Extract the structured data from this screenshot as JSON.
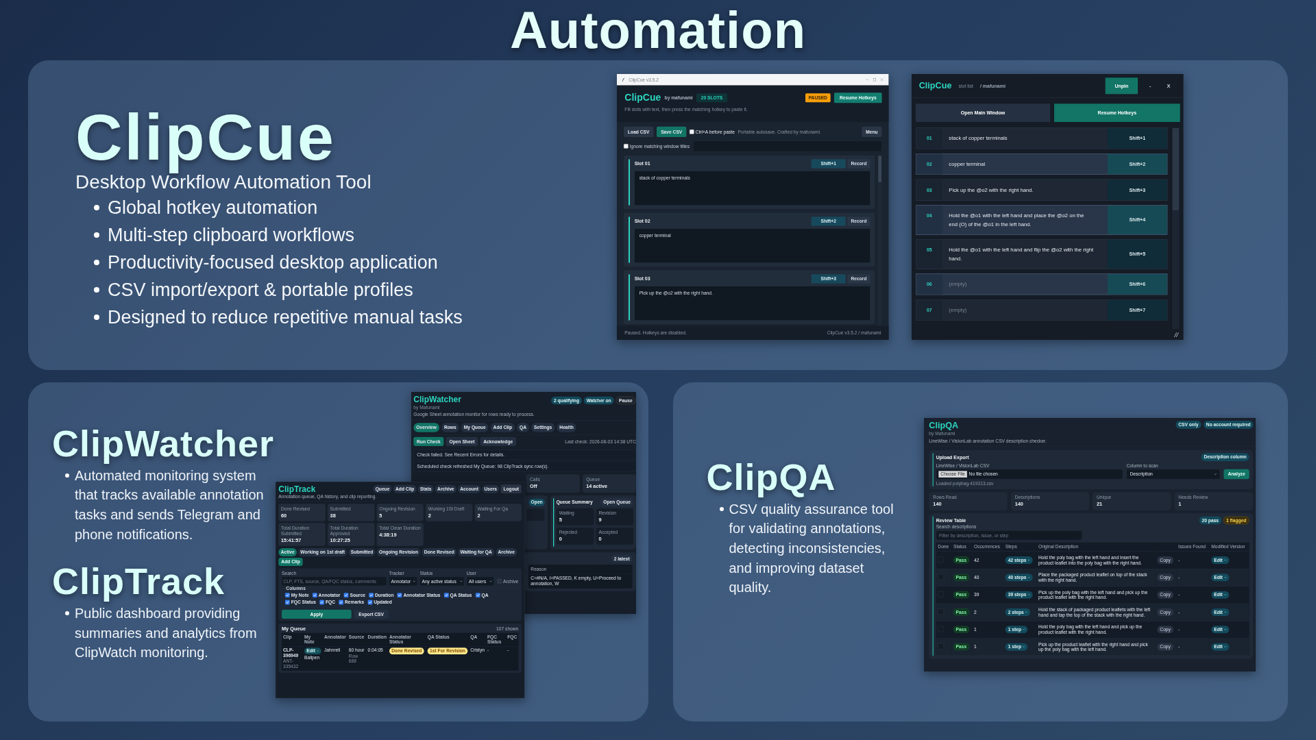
{
  "heading": "Automation",
  "clipcue": {
    "name": "ClipCue",
    "tagline": "Desktop Workflow Automation Tool",
    "features": [
      "Global hotkey automation",
      "Multi-step clipboard workflows",
      "Productivity-focused desktop application",
      "CSV import/export & portable profiles",
      "Designed to reduce repetitive manual tasks"
    ],
    "main_window": {
      "titlebar": "ClipCue v3.5.2",
      "app_name": "ClipCue",
      "by": "by mafunami",
      "slots_badge": "20 SLOTS",
      "status_badge": "PAUSED",
      "resume_button": "Resume Hotkeys",
      "hint": "Fill slots with text, then press the matching hotkey to paste it.",
      "load_button": "Load CSV",
      "save_button": "Save CSV",
      "ctrl_a": {
        "label": "Ctrl+A before paste",
        "checked": false
      },
      "note": "Portable autosave. Crafted by mafunami.",
      "menu_button": "Menu",
      "ignore_titles": {
        "label": "Ignore matching window titles",
        "checked": false
      },
      "slots": [
        {
          "title": "Slot 01",
          "hotkey": "Shift+1",
          "record": "Record",
          "text": "stack of copper terminals"
        },
        {
          "title": "Slot 02",
          "hotkey": "Shift+2",
          "record": "Record",
          "text": "copper terminal"
        },
        {
          "title": "Slot 03",
          "hotkey": "Shift+3",
          "record": "Record",
          "text": "Pick up the @o2 with the right hand."
        }
      ],
      "status": "Paused. Hotkeys are disabled.",
      "version": "ClipCue v3.5.2 / mafunami"
    },
    "slot_list_window": {
      "app_name": "ClipCue",
      "subtitle": "slot list",
      "user": "/ mafunami",
      "unpin_button": "Unpin",
      "minimize_button": "-",
      "close_button": "X",
      "open_main_button": "Open Main Window",
      "resume_button": "Resume Hotkeys",
      "slots": [
        {
          "number": "01",
          "text": "stack of copper terminals",
          "hotkey": "Shift+1",
          "highlighted": false,
          "empty": false
        },
        {
          "number": "02",
          "text": "copper terminal",
          "hotkey": "Shift+2",
          "highlighted": true,
          "empty": false
        },
        {
          "number": "03",
          "text": "Pick up the @o2 with the right hand.",
          "hotkey": "Shift+3",
          "highlighted": false,
          "empty": false
        },
        {
          "number": "04",
          "text": "Hold the @o1 with the left hand and place the @o2 on the end (O) of the @o1 in the left hand.",
          "hotkey": "Shift+4",
          "highlighted": true,
          "empty": false
        },
        {
          "number": "05",
          "text": "Hold the @o1 with the left hand and flip the @o2 with the right hand.",
          "hotkey": "Shift+5",
          "highlighted": false,
          "empty": false
        },
        {
          "number": "06",
          "text": "(empty)",
          "hotkey": "Shift+6",
          "highlighted": true,
          "empty": true
        },
        {
          "number": "07",
          "text": "(empty)",
          "hotkey": "Shift+7",
          "highlighted": false,
          "empty": true
        }
      ]
    }
  },
  "clipwatcher": {
    "name": "ClipWatcher",
    "features": [
      "Automated monitoring system that tracks available annotation tasks and sends Telegram and phone notifications."
    ],
    "window": {
      "app_name": "ClipWatcher",
      "by": "by Mafunami",
      "description": "Google Sheet annotation monitor for rows ready to process.",
      "badges": [
        "2 qualifying",
        "Watcher on"
      ],
      "pause_button": "Pause",
      "tabs": [
        {
          "label": "Overview",
          "selected": true
        },
        {
          "label": "Rows",
          "selected": false
        },
        {
          "label": "My Queue",
          "selected": false
        },
        {
          "label": "Add Clip",
          "selected": false
        },
        {
          "label": "QA",
          "selected": false
        },
        {
          "label": "Settings",
          "selected": false
        },
        {
          "label": "Health",
          "selected": false
        }
      ],
      "actions": [
        {
          "label": "Run Check",
          "kind": "primary"
        },
        {
          "label": "Open Sheet",
          "kind": "secondary"
        },
        {
          "label": "Acknowledge",
          "kind": "secondary"
        }
      ],
      "last_check": "Last check: 2026-08-03 14:38 UTC",
      "alerts": [
        "Check failed. See Recent Errors for details.",
        "Scheduled check refreshed My Queue: 98 ClipTrack sync row(s)."
      ],
      "stats": [
        {
          "label": "Calls",
          "value": "Off"
        },
        {
          "label": "Queue",
          "value": "14 active"
        }
      ],
      "open_badge": "Open",
      "queue_summary": {
        "title": "Queue Summary",
        "button": "Open Queue",
        "cells": [
          {
            "label": "Waiting",
            "value": "5"
          },
          {
            "label": "Revision",
            "value": "9"
          },
          {
            "label": "Rejected",
            "value": "0"
          },
          {
            "label": "Accepted",
            "value": "0"
          }
        ]
      },
      "latest_badge": "2 latest",
      "reason_header": "Reason",
      "reason_text": "C=#N/A, I=PASSED, K empty, U=Proceed to annotation, W"
    }
  },
  "cliptrack": {
    "name": "ClipTrack",
    "features": [
      "Public dashboard providing summaries and analytics from ClipWatch monitoring."
    ],
    "window": {
      "app_name": "ClipTrack",
      "description": "Annotation queue, QA history, and clip reporting.",
      "nav": [
        {
          "label": "Queue",
          "kind": "pill"
        },
        {
          "label": "Add Clip",
          "kind": "pill"
        },
        {
          "label": "Stats",
          "kind": "pill"
        },
        {
          "label": "Archive",
          "kind": "pill"
        },
        {
          "label": "Account",
          "kind": "pill"
        },
        {
          "label": "Users",
          "kind": "pill"
        },
        {
          "label": "Logout",
          "kind": "button"
        }
      ],
      "stats": [
        {
          "label": "Done Revised",
          "value": "60"
        },
        {
          "label": "Submitted",
          "value": "38"
        },
        {
          "label": "Ongoing Revision",
          "value": "5"
        },
        {
          "label": "Working 1St Draft",
          "value": "2"
        },
        {
          "label": "Waiting For Qa",
          "value": "2"
        },
        {
          "label": "Total Duration Submitted",
          "value": "15:41:57"
        },
        {
          "label": "Total Duration Approved",
          "value": "10:27:25"
        },
        {
          "label": "Total Clean Duration",
          "value": "4:38:19"
        }
      ],
      "filters": [
        {
          "label": "Active",
          "selected": true
        },
        {
          "label": "Working on 1st draft",
          "selected": false
        },
        {
          "label": "Submitted",
          "selected": false
        },
        {
          "label": "Ongoing Revision",
          "selected": false
        },
        {
          "label": "Done Revised",
          "selected": false
        },
        {
          "label": "Waiting for QA",
          "selected": false
        },
        {
          "label": "Archive",
          "selected": false
        }
      ],
      "add_clip_button": "Add Clip",
      "search": {
        "label": "Search",
        "placeholder": "CLP, FTS, source, QA/FQC status, comments"
      },
      "tracker": {
        "label": "Tracker",
        "value": "Annotator"
      },
      "status": {
        "label": "Status",
        "value": "Any active status"
      },
      "user": {
        "label": "User",
        "value": "All users"
      },
      "archive": {
        "label": "Archive",
        "checked": false
      },
      "columns_legend": "Columns",
      "columns": [
        {
          "label": "My Note",
          "checked": true
        },
        {
          "label": "Annotator",
          "checked": true
        },
        {
          "label": "Source",
          "checked": true
        },
        {
          "label": "Duration",
          "checked": true
        },
        {
          "label": "Annotator Status",
          "checked": true
        },
        {
          "label": "QA Status",
          "checked": true
        },
        {
          "label": "QA",
          "checked": true
        },
        {
          "label": "FQC Status",
          "checked": true
        },
        {
          "label": "FQC",
          "checked": true
        },
        {
          "label": "Remarks",
          "checked": true
        },
        {
          "label": "Updated",
          "checked": true
        }
      ],
      "apply_button": "Apply",
      "export_button": "Export CSV",
      "queue": {
        "title": "My Queue",
        "count": "107 shown",
        "columns": [
          "Clip",
          "My Note",
          "Annotator",
          "Source",
          "Duration",
          "Annotator Status",
          "QA Status",
          "QA",
          "FQC Status",
          "FQC"
        ],
        "rows": [
          {
            "clip": "CLP-396949",
            "clip_id": "ANT-335432",
            "note_button": "Edit",
            "note": "Ballpen",
            "annotator": "Jahnrell",
            "source": "60 hour",
            "source_row": "Row 688",
            "duration": "0:04:05",
            "annotator_status": "Done Revised",
            "qa_status": "1st For Revision",
            "qa": "Cristyn",
            "fqc_status": "-",
            "fqc": "-"
          }
        ]
      }
    }
  },
  "clipqa": {
    "name": "ClipQA",
    "features": [
      "CSV quality assurance tool for validating annotations, detecting inconsistencies, and improving dataset quality."
    ],
    "window": {
      "app_name": "ClipQA",
      "by": "by Mafunami",
      "description": "LineWise / VisionLab annotation CSV description checker.",
      "badges": [
        "CSV only",
        "No account required"
      ],
      "upload": {
        "title": "Upload Export",
        "badge": "Description column",
        "file_label": "LineWise / VisionLab CSV",
        "choose_button": "Choose File",
        "no_file": "No file chosen",
        "column_label": "Column to scan",
        "column_value": "Description",
        "analyze_button": "Analyze",
        "loaded": "Loaded polybag-419313.csv"
      },
      "stats": [
        {
          "label": "Rows Read",
          "value": "140"
        },
        {
          "label": "Descriptions",
          "value": "140"
        },
        {
          "label": "Unique",
          "value": "21"
        },
        {
          "label": "Needs Review",
          "value": "1"
        }
      ],
      "review": {
        "title": "Review Table",
        "pass_badge": "20 pass",
        "flag_badge": "1 flagged",
        "search_label": "Search descriptions",
        "search_placeholder": "Filter by description, issue, or step",
        "columns": [
          "Done",
          "Status",
          "Occurrences",
          "Steps",
          "Original Description",
          "Issues Found",
          "Modified Version"
        ],
        "rows": [
          {
            "done": false,
            "status": "Pass",
            "occurrences": "42",
            "steps": "42 steps",
            "description": "Hold the poly bag with the left hand and insert the product leaflet into the poly bag with the right hand.",
            "copy": "Copy",
            "issues": "-",
            "edit": "Edit"
          },
          {
            "done": false,
            "status": "Pass",
            "occurrences": "40",
            "steps": "40 steps",
            "description": "Place the packaged product leaflet on top of the stack with the right hand.",
            "copy": "Copy",
            "issues": "-",
            "edit": "Edit"
          },
          {
            "done": false,
            "status": "Pass",
            "occurrences": "39",
            "steps": "39 steps",
            "description": "Pick up the poly bag with the left hand and pick up the product leaflet with the right hand.",
            "copy": "Copy",
            "issues": "-",
            "edit": "Edit"
          },
          {
            "done": false,
            "status": "Pass",
            "occurrences": "2",
            "steps": "2 steps",
            "description": "Hold the stack of packaged product leaflets with the left hand and tap the top of the stack with the right hand.",
            "copy": "Copy",
            "issues": "-",
            "edit": "Edit"
          },
          {
            "done": false,
            "status": "Pass",
            "occurrences": "1",
            "steps": "1 step",
            "description": "Hold the poly bag with the left hand and pick up the product leaflet with the right hand.",
            "copy": "Copy",
            "issues": "-",
            "edit": "Edit"
          },
          {
            "done": false,
            "status": "Pass",
            "occurrences": "1",
            "steps": "1 step",
            "description": "Pick up the product leaflet with the right hand and pick up the poly bag with the left hand.",
            "copy": "Copy",
            "issues": "-",
            "edit": "Edit"
          }
        ]
      }
    }
  }
}
